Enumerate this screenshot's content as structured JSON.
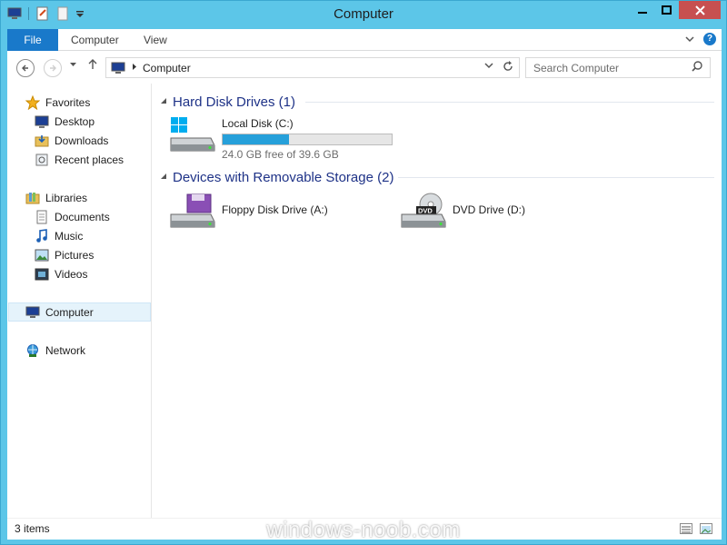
{
  "window": {
    "title": "Computer"
  },
  "ribbon": {
    "tabs": [
      "File",
      "Computer",
      "View"
    ]
  },
  "address": {
    "path": "Computer"
  },
  "search": {
    "placeholder": "Search Computer"
  },
  "sidebar": {
    "favorites": {
      "label": "Favorites",
      "items": [
        "Desktop",
        "Downloads",
        "Recent places"
      ]
    },
    "libraries": {
      "label": "Libraries",
      "items": [
        "Documents",
        "Music",
        "Pictures",
        "Videos"
      ]
    },
    "computer": "Computer",
    "network": "Network"
  },
  "groups": {
    "hdd": {
      "header": "Hard Disk Drives (1)",
      "drives": [
        {
          "name": "Local Disk (C:)",
          "free_text": "24.0 GB free of 39.6 GB",
          "used_fraction": 0.394
        }
      ]
    },
    "removable": {
      "header": "Devices with Removable Storage (2)",
      "drives": [
        {
          "name": "Floppy Disk Drive (A:)",
          "icon": "floppy-drive-icon"
        },
        {
          "name": "DVD Drive (D:)",
          "icon": "dvd-drive-icon"
        }
      ]
    }
  },
  "status": {
    "items_text": "3 items"
  },
  "watermark": "windows-noob.com",
  "colors": {
    "accent": "#1979ca",
    "usage": "#26a0da",
    "chrome": "#5cc6e8",
    "group_header": "#1e3287"
  }
}
